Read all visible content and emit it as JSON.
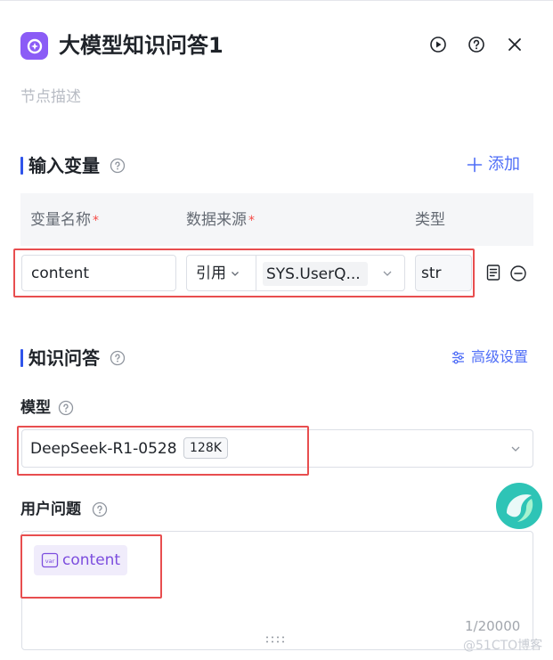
{
  "header": {
    "title": "大模型知识问答1",
    "description_placeholder": "节点描述"
  },
  "input_section": {
    "title": "输入变量",
    "add_label": "添加",
    "columns": {
      "name": "变量名称",
      "source": "数据来源",
      "type": "类型"
    },
    "required_mark": "*",
    "row": {
      "name_value": "content",
      "source_mode": "引用",
      "source_value": "SYS.UserQ...",
      "type_value": "str"
    }
  },
  "qa_section": {
    "title": "知识问答",
    "advanced_label": "高级设置",
    "model_label": "模型",
    "model_value": "DeepSeek-R1-0528",
    "model_tag": "128K",
    "question_label": "用户问题",
    "var_icon_text": "var",
    "question_var": "content",
    "counter": "1/20000"
  },
  "watermark": "@51CTO博客",
  "colors": {
    "accent": "#4f6ef7",
    "node_icon": "#8b5cf6",
    "highlight_frame": "#e84e4f",
    "chip_text": "#7c4dde"
  }
}
